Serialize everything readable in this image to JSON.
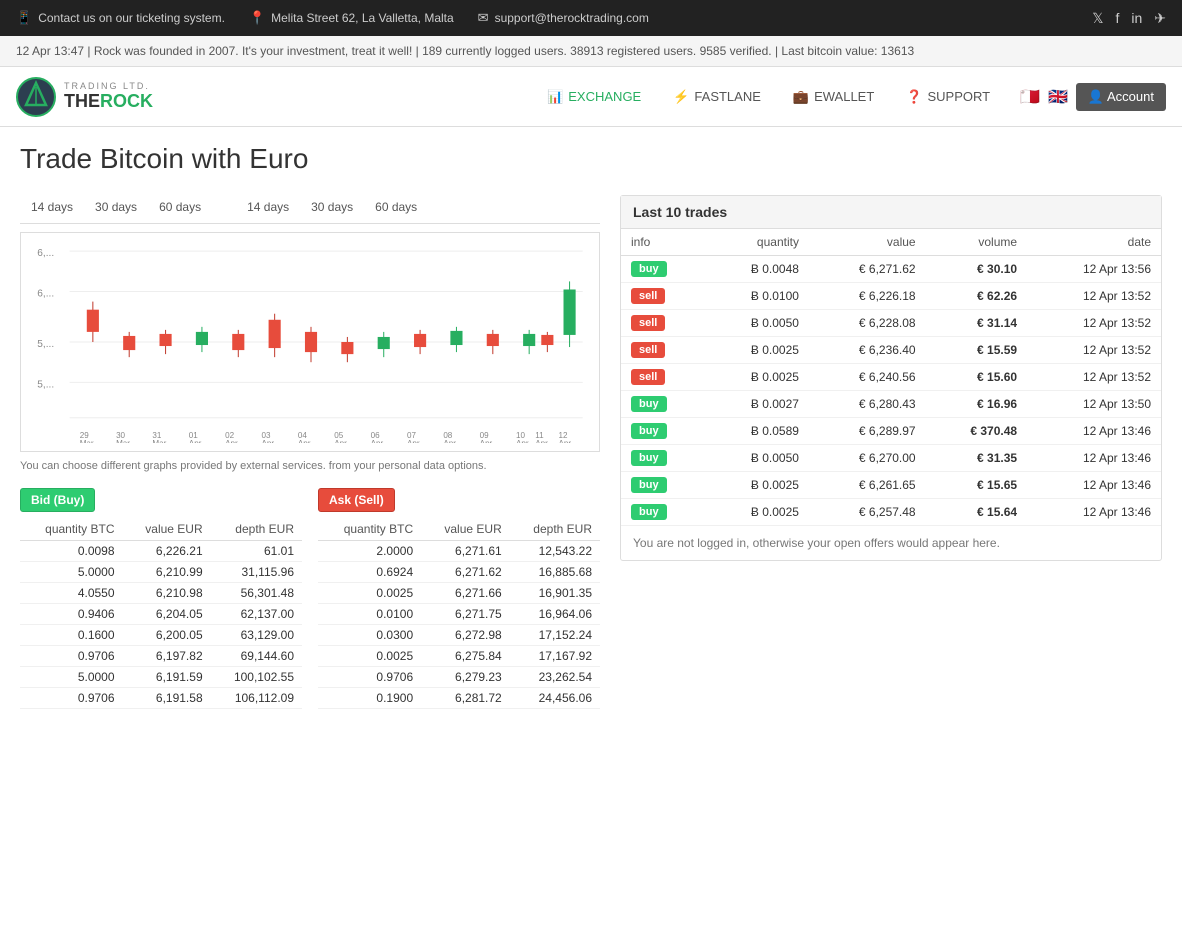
{
  "topbar": {
    "contact": "Contact us on our ticketing system.",
    "address": "Melita Street 62, La Valletta, Malta",
    "email": "support@therocktrading.com",
    "contact_icon": "📱",
    "address_icon": "📍",
    "email_icon": "✉"
  },
  "ticker": {
    "text": "12 Apr 13:47  |  Rock was founded in 2007. It's your investment, treat it well!  |  189 currently logged users. 38913 registered users. 9585 verified.  |  Last bitcoin value: 13613"
  },
  "nav": {
    "exchange_label": "EXCHANGE",
    "fastlane_label": "FASTLANE",
    "ewallet_label": "EWALLET",
    "support_label": "SUPPORT",
    "account_label": "Account"
  },
  "page": {
    "title": "Trade Bitcoin with Euro"
  },
  "chart_tabs": {
    "group1": [
      "14 days",
      "30 days",
      "60 days"
    ],
    "group2": [
      "14 days",
      "30 days",
      "60 days"
    ]
  },
  "chart_note": "You can choose different graphs provided by external services. from your personal data options.",
  "chart_x_labels": [
    "29 Mar",
    "30 Mar",
    "31 Mar",
    "01 Apr",
    "02 Apr",
    "03 Apr",
    "04 Apr",
    "05 Apr",
    "06 Apr",
    "07 Apr",
    "08 Apr",
    "09 Apr",
    "10 Apr",
    "11 Apr",
    "12 Apr"
  ],
  "chart_y_labels": [
    "6,...",
    "6,...",
    "5,...",
    "5,..."
  ],
  "bid_table": {
    "title": "Bid (Buy)",
    "headers": [
      "quantity BTC",
      "value EUR",
      "depth EUR"
    ],
    "rows": [
      [
        "0.0098",
        "6,226.21",
        "61.01"
      ],
      [
        "5.0000",
        "6,210.99",
        "31,115.96"
      ],
      [
        "4.0550",
        "6,210.98",
        "56,301.48"
      ],
      [
        "0.9406",
        "6,204.05",
        "62,137.00"
      ],
      [
        "0.1600",
        "6,200.05",
        "63,129.00"
      ],
      [
        "0.9706",
        "6,197.82",
        "69,144.60"
      ],
      [
        "5.0000",
        "6,191.59",
        "100,102.55"
      ],
      [
        "0.9706",
        "6,191.58",
        "106,112.09"
      ]
    ]
  },
  "ask_table": {
    "title": "Ask (Sell)",
    "headers": [
      "quantity BTC",
      "value EUR",
      "depth EUR"
    ],
    "rows": [
      [
        "2.0000",
        "6,271.61",
        "12,543.22"
      ],
      [
        "0.6924",
        "6,271.62",
        "16,885.68"
      ],
      [
        "0.0025",
        "6,271.66",
        "16,901.35"
      ],
      [
        "0.0100",
        "6,271.75",
        "16,964.06"
      ],
      [
        "0.0300",
        "6,272.98",
        "17,152.24"
      ],
      [
        "0.0025",
        "6,275.84",
        "17,167.92"
      ],
      [
        "0.9706",
        "6,279.23",
        "23,262.54"
      ],
      [
        "0.1900",
        "6,281.72",
        "24,456.06"
      ]
    ]
  },
  "trades": {
    "title": "Last 10 trades",
    "headers": [
      "info",
      "quantity",
      "value",
      "volume",
      "date"
    ],
    "rows": [
      {
        "type": "buy",
        "quantity": "Ƀ 0.0048",
        "value": "€ 6,271.62",
        "volume": "€ 30.10",
        "date": "12 Apr 13:56"
      },
      {
        "type": "sell",
        "quantity": "Ƀ 0.0100",
        "value": "€ 6,226.18",
        "volume": "€ 62.26",
        "date": "12 Apr 13:52"
      },
      {
        "type": "sell",
        "quantity": "Ƀ 0.0050",
        "value": "€ 6,228.08",
        "volume": "€ 31.14",
        "date": "12 Apr 13:52"
      },
      {
        "type": "sell",
        "quantity": "Ƀ 0.0025",
        "value": "€ 6,236.40",
        "volume": "€ 15.59",
        "date": "12 Apr 13:52"
      },
      {
        "type": "sell",
        "quantity": "Ƀ 0.0025",
        "value": "€ 6,240.56",
        "volume": "€ 15.60",
        "date": "12 Apr 13:52"
      },
      {
        "type": "buy",
        "quantity": "Ƀ 0.0027",
        "value": "€ 6,280.43",
        "volume": "€ 16.96",
        "date": "12 Apr 13:50"
      },
      {
        "type": "buy",
        "quantity": "Ƀ 0.0589",
        "value": "€ 6,289.97",
        "volume": "€ 370.48",
        "date": "12 Apr 13:46"
      },
      {
        "type": "buy",
        "quantity": "Ƀ 0.0050",
        "value": "€ 6,270.00",
        "volume": "€ 31.35",
        "date": "12 Apr 13:46"
      },
      {
        "type": "buy",
        "quantity": "Ƀ 0.0025",
        "value": "€ 6,261.65",
        "volume": "€ 15.65",
        "date": "12 Apr 13:46"
      },
      {
        "type": "buy",
        "quantity": "Ƀ 0.0025",
        "value": "€ 6,257.48",
        "volume": "€ 15.64",
        "date": "12 Apr 13:46"
      }
    ],
    "not_logged": "You are not logged in, otherwise your open offers would appear here."
  }
}
